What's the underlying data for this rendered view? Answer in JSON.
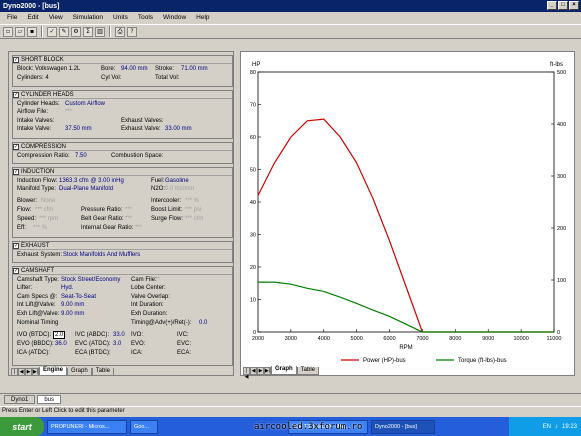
{
  "window": {
    "title": "Dyno2000 - [bus]"
  },
  "menu": [
    "File",
    "Edit",
    "View",
    "Simulation",
    "Units",
    "Tools",
    "Window",
    "Help"
  ],
  "short_block": {
    "title": "SHORT BLOCK",
    "block": "Block: Volkswagen 1.2L",
    "bore_label": "Bore:",
    "bore": "94.00 mm",
    "stroke_label": "Stroke:",
    "stroke": "71.00 mm",
    "cylinders": "Cylinders: 4",
    "cyl_vol": "Cyl Vol:",
    "total_vol": "Total Vol:"
  },
  "cylinder_heads": {
    "title": "CYLINDER HEADS",
    "heads_label": "Cylinder Heads:",
    "heads": "Custom Airflow",
    "airflow_file": "Airflow File:",
    "airflow_val": "***",
    "intake_valves": "Intake Valves:",
    "exhaust_valves": "Exhaust Valves:",
    "intake_valve_label": "Intake Valve:",
    "intake_valve": "37.50 mm",
    "exhaust_valve_label": "Exhaust Valve:",
    "exhaust_valve": "33.00 mm"
  },
  "compression": {
    "title": "COMPRESSION",
    "ratio_label": "Compression Ratio:",
    "ratio": "7.50",
    "space_label": "Combustion Space:"
  },
  "induction": {
    "title": "INDUCTION",
    "flow_label": "Induction Flow:",
    "flow": "1363.3 cfm @ 3.00 inHg",
    "fuel_label": "Fuel:",
    "fuel": "Gasoline",
    "manifold_label": "Manifold Type:",
    "manifold": "Dual-Plane Manifold",
    "n2o_label": "N2O:",
    "n2o": "0.0 lbs/min",
    "blower_label": "Blower:",
    "blower": "None",
    "intercooler_label": "Intercooler:",
    "intercooler": "*** %",
    "flow2_label": "Flow:",
    "flow2": "*** cfm",
    "pressure_label": "Pressure Ratio:",
    "pressure": "***",
    "boost_label": "Boost Limit:",
    "boost": "*** psi",
    "speed_label": "Speed:",
    "speed": "*** rpm",
    "belt_label": "Belt Gear Ratio:",
    "belt": "***",
    "surge_label": "Surge Flow:",
    "surge": "*** cfm",
    "eff_label": "Eff:",
    "eff": "*** %",
    "internal_label": "Internal Gear Ratio:",
    "internal": "***"
  },
  "exhaust": {
    "title": "EXHAUST",
    "system_label": "Exhaust System:",
    "system": "Stock Manifolds And Mufflers"
  },
  "camshaft": {
    "title": "CAMSHAFT",
    "type_label": "Camshaft Type:",
    "type": "Stock Street/Economy",
    "file_label": "Cam File:",
    "file": "***",
    "lifter_label": "Lifter:",
    "lifter": "Hyd.",
    "lobe_label": "Lobe Center:",
    "specs_label": "Cam Specs @:",
    "specs": "Seat-To-Seat",
    "overlap_label": "Valve Overlap:",
    "int_lift_label": "Int Lift@Valve:",
    "int_lift": "9.00 mm",
    "int_dur_label": "Int Duration:",
    "exh_lift_label": "Exh Lift@Valve:",
    "exh_lift": "9.00 mm",
    "exh_dur_label": "Exh Duration:",
    "nominal": "Nominal Timing",
    "timing_label": "Timing@Adv(+)/Ret(-):",
    "timing": "0.0",
    "ivo_label": "IVO (BTDC):",
    "ivo": "2.0",
    "ivc_label": "IVC (ABDC):",
    "ivc": "33.0",
    "ivo2": "IVO:",
    "ivc2": "IVC:",
    "evo_label": "EVO (BBDC):",
    "evo": "36.0",
    "evc_label": "EVC (ATDC):",
    "evc": "3.0",
    "evo2": "EVO:",
    "evc2": "EVC:",
    "ica_label": "ICA (ATDC):",
    "eca_label": "ECA (BTDC):",
    "ica2": "ICA:",
    "eca2": "ECA:"
  },
  "left_tabs": [
    "Engine",
    "Graph",
    "Table"
  ],
  "right_tabs": [
    "Graph",
    "Table"
  ],
  "doc_tabs": [
    "Dyno1",
    "bus"
  ],
  "status": "Press Enter or Left Click to edit this parameter",
  "taskbar": {
    "start": "start",
    "tasks": [
      "PROPUNERI - Micros...",
      "Goo...",
      "RLF T3 1,6l LBX - Mic...",
      "Dyno2000 - [bus]"
    ],
    "lang": "EN",
    "clock": "19:23"
  },
  "watermark": "aircooled.3xforum.ro",
  "chart_data": {
    "type": "line",
    "xlabel": "RPM",
    "ylabel_left": "HP",
    "ylabel_right": "ft-lbs",
    "xlim": [
      2000,
      11000
    ],
    "ylim_left": [
      0,
      80
    ],
    "ylim_right": [
      0,
      500
    ],
    "x_ticks": [
      2000,
      3000,
      4000,
      5000,
      6000,
      7000,
      8000,
      9000,
      10000,
      11000
    ],
    "y_ticks_left": [
      0,
      10,
      20,
      30,
      40,
      50,
      60,
      70,
      80
    ],
    "y_ticks_right": [
      0,
      100,
      200,
      300,
      400,
      500
    ],
    "grid": false,
    "legend_position": "bottom",
    "series": [
      {
        "name": "Power (HP)-bus",
        "color": "#d00000",
        "axis": "left",
        "x": [
          2000,
          2500,
          3000,
          3500,
          4000,
          4500,
          5000,
          5500,
          6000,
          6500,
          7000,
          8000,
          9000,
          10000,
          11000
        ],
        "values": [
          42,
          52,
          60,
          65,
          65.5,
          60,
          52,
          41,
          28,
          14,
          0,
          0,
          0,
          0,
          0
        ]
      },
      {
        "name": "Torque (ft-lbs)-bus",
        "color": "#008000",
        "axis": "right",
        "x": [
          2000,
          2500,
          3000,
          3500,
          4000,
          4500,
          5000,
          5500,
          6000,
          6500,
          7000,
          8000,
          9000,
          10000,
          11000
        ],
        "values": [
          96,
          96,
          92,
          84,
          78,
          67,
          55,
          42,
          30,
          15,
          0,
          0,
          0,
          0,
          0
        ]
      }
    ]
  }
}
